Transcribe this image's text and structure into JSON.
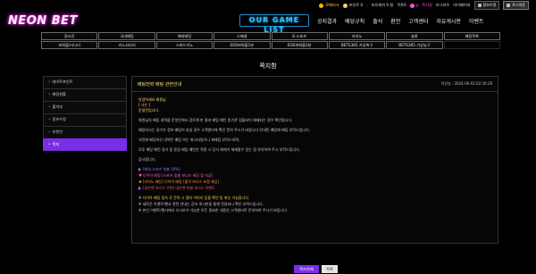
{
  "userbar": {
    "level": "로베타크",
    "gold": "포인트 0",
    "point_label": "보유캐쉬 0 원",
    "coupon": "쿠폰0",
    "messages": "0",
    "items": [
      "쪽지함",
      "보그하우",
      "마이페이지"
    ],
    "buttons": [
      "정보수정",
      "로그아웃"
    ]
  },
  "header": {
    "logo": "NEON BET",
    "game_list": "OUR GAME LIST",
    "nav": [
      "공지결과",
      "배당규칙",
      "출석",
      "환전",
      "고객센터",
      "자유게시판",
      "이벤트"
    ]
  },
  "categories": [
    [
      "정시진",
      "국내배팅",
      "해외배팅",
      "스페셜",
      "E-스포츠",
      "카지노",
      "슬롯",
      "배팅목록"
    ],
    [
      "파워볼/사다리",
      "키노사다리",
      "스피드키노",
      "EOS파워볼1분",
      "EOS파워볼2분",
      "BETS365 가상축구",
      "BETS365 가상농구",
      ""
    ]
  ],
  "page": {
    "title": "쪽지함"
  },
  "side_menu": [
    {
      "label": "데이트포인트",
      "active": false
    },
    {
      "label": "배팅현황",
      "active": false
    },
    {
      "label": "출석부",
      "active": false
    },
    {
      "label": "정보수정",
      "active": false
    },
    {
      "label": "추천인",
      "active": false
    },
    {
      "label": "쪽지",
      "active": true
    }
  ],
  "message": {
    "title": "베팅전략 배팅 관련안내",
    "date": "작성일 : 2024-06-02 02:30:28",
    "greeting1": "안녕하세요 회원님",
    "greeting_name": "네온",
    "greeting2": "운영진입니다.",
    "paragraphs": [
      "회원님의 배팅 내역을 운영진에서 검토해 본 결과 배팅 패턴 정기관 검출되어 제재되는 경우 확인됩니다.",
      "배팅하시는 경기가 정보 배팅이 되실 경우 고객센터에 확인 문의 주시기 바랍니다 안내된 배팅에 배팅 부탁드립니다.",
      "지린에 배팅하신 내역은 배팅 하는 위시되었으니 재배팅 부탁드리며,",
      "추후 배팅 패턴 경기 및 동일 배팅 패턴은 적용 시 당사 제재가 제재될수 있는 점 유의하여 주시 부탁드립니다.",
      "감사합니다."
    ],
    "promo_lines": [
      "[최대 스포츠 첫충 10%]",
      "다이아 배팅 [스포츠 맞춤 보너스 제공 및 지급]",
      "[카지노 배당] 다이아 배팅 [출석 보너스 포함 제공]",
      "[네온벳 보너스 쿠폰] 네온벳 특별 보너스 이벤트"
    ],
    "notices": [
      "※ 다이아 배팅 접속 후 문의 시 캡처 이미지 등을 확인 및 회신 가능합니다.",
      "※ 새로운 이벤트/행사 관련 안내는 공지 게시판을 통해 전달되니 확인 부탁드립니다.",
      "※ 본인 이벤트/행사에서 다시보기 가능한 모든 중요한 내용은 고객센터로 문의하여 주시기 바랍니다."
    ]
  },
  "actions": {
    "delete": "쪽지삭제",
    "list": "목록"
  }
}
